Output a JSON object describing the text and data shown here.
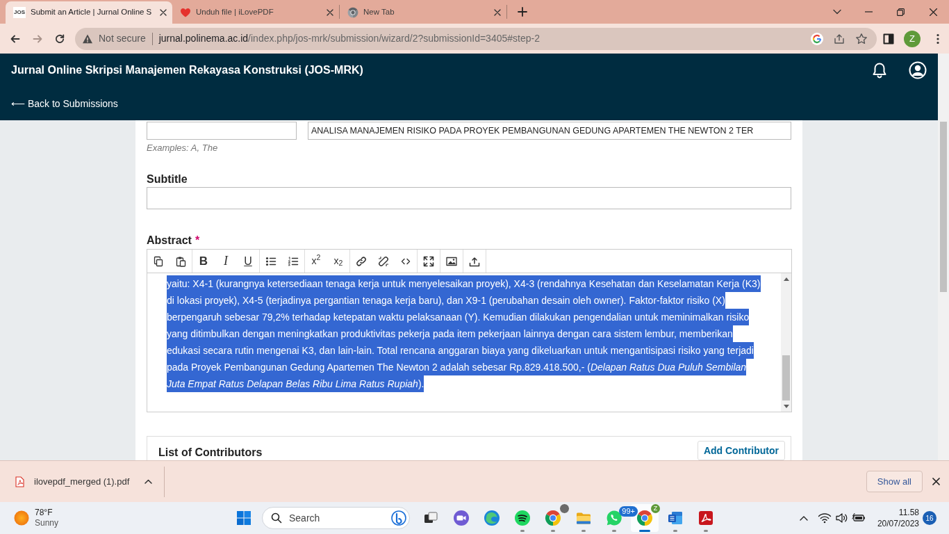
{
  "browser": {
    "tabs": [
      {
        "kind": "logo",
        "logo_text": "JOS",
        "title": "Submit an Article | Jurnal Online S",
        "selected": true
      },
      {
        "kind": "heart",
        "title": "Unduh file | iLovePDF",
        "selected": false
      },
      {
        "kind": "chrome",
        "title": "New Tab",
        "selected": false
      }
    ],
    "nav": [
      {
        "kind": "back",
        "disabled": false
      },
      {
        "kind": "forward",
        "disabled": true
      },
      {
        "kind": "reload",
        "disabled": false
      }
    ],
    "address_bar": {
      "security": "Not secure",
      "host": "jurnal.polinema.ac.id",
      "path": "/index.php/jos-mrk/submission/wizard/2?submissionId=3405#step-2"
    },
    "profile_initial": "Z"
  },
  "site": {
    "title": "Jurnal Online Skripsi Manajemen Rekayasa Konstruksi (JOS-MRK)",
    "back_link": "⟵ Back to Submissions"
  },
  "form": {
    "prefix": {
      "help": "Examples: A, The"
    },
    "title_field": {
      "value": "ANALISA MANAJEMEN RISIKO PADA PROYEK PEMBANGUNAN GEDUNG APARTEMEN THE NEWTON 2 TER"
    },
    "subtitle": {
      "label": "Subtitle"
    },
    "abstract": {
      "label": "Abstract",
      "required_mark": "*",
      "toolbar": [
        [
          {
            "kind": "copy"
          },
          {
            "kind": "paste"
          }
        ],
        [
          {
            "kind": "bold",
            "label": "B"
          },
          {
            "kind": "italic",
            "label": "I"
          },
          {
            "kind": "underline",
            "label": "U"
          }
        ],
        [
          {
            "kind": "bullets"
          },
          {
            "kind": "numbering"
          }
        ],
        [
          {
            "kind": "superscript",
            "label": "x$^{2}$"
          },
          {
            "kind": "subscript",
            "label": "x$_{2}$"
          }
        ],
        [
          {
            "kind": "link"
          },
          {
            "kind": "unlink"
          },
          {
            "kind": "code"
          }
        ],
        [
          {
            "kind": "fullscreen"
          }
        ],
        [
          {
            "kind": "image"
          }
        ],
        [
          {
            "kind": "upload"
          }
        ]
      ],
      "text": "yaitu: X4-1 (kurangnya ketersediaan tenaga kerja untuk menyelesaikan proyek), X4-3 (rendahnya Kesehatan dan Keselamatan Kerja (K3) di lokasi proyek), X4-5 (terjadinya pergantian tenaga kerja baru), dan X9-1 (perubahan desain oleh owner). Faktor-faktor risiko (X) berpengaruh sebesar 79,2% terhadap ketepatan waktu pelaksanaan (Y). Kemudian dilakukan pengendalian untuk meminimalkan risiko yang ditimbulkan dengan meningkatkan produktivitas pekerja pada item pekerjaan lainnya dengan cara sistem lembur, memberikan edukasi secara rutin mengenai K3, dan lain-lain. Total rencana anggaran biaya yang dikeluarkan untuk mengantisipasi risiko yang terjadi pada Proyek Pembangunan Gedung Apartemen The Newton 2 adalah sebesar Rp.829.418.500,- (*Delapan Ratus Dua Puluh Sembilan Juta Empat Ratus Delapan Belas Ribu Lima Ratus Rupiah*).",
      "text_selected": true
    }
  },
  "contributors": {
    "title": "List of Contributors",
    "add_button": "Add Contributor"
  },
  "downloads": {
    "file": "ilovepdf_merged (1).pdf",
    "show_all": "Show all"
  },
  "taskbar": {
    "weather": {
      "temperature": "78°F",
      "condition": "Sunny"
    },
    "search": {
      "placeholder": "Search"
    },
    "apps": [
      {
        "kind": "taskview",
        "running": false,
        "selected": false
      },
      {
        "kind": "camera",
        "running": false,
        "selected": false
      },
      {
        "kind": "swirl",
        "running": false,
        "selected": false
      },
      {
        "kind": "waves",
        "running": true,
        "selected": false
      },
      {
        "kind": "browser",
        "running": true,
        "selected": false,
        "badge": {
          "kind": "photo"
        }
      },
      {
        "kind": "folder",
        "running": true,
        "selected": false
      },
      {
        "kind": "phone",
        "running": true,
        "selected": false,
        "badge": {
          "kind": "count",
          "text": "99+"
        }
      },
      {
        "kind": "browser",
        "running": true,
        "selected": true,
        "badge": {
          "kind": "letter",
          "text": "Z"
        }
      },
      {
        "kind": "document",
        "running": true,
        "selected": false
      },
      {
        "kind": "pdf",
        "running": true,
        "selected": false
      }
    ],
    "clock": {
      "time": "11.58",
      "date": "20/07/2023"
    },
    "notification_count": "16"
  }
}
